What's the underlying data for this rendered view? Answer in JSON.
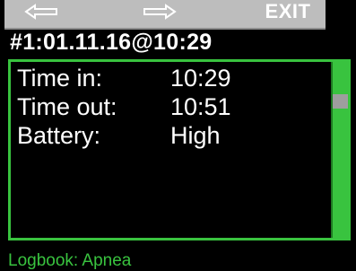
{
  "softkeys": {
    "left_icon": "arrow-left-icon",
    "right_icon": "arrow-right-icon",
    "exit_label": "EXIT"
  },
  "header": {
    "title": "#1:01.11.16@10:29"
  },
  "details": [
    {
      "label": "Time in:",
      "value": "10:29"
    },
    {
      "label": "Time out:",
      "value": "10:51"
    },
    {
      "label": "Battery:",
      "value": "High"
    }
  ],
  "scrollbar": {
    "position_fraction": 0.2
  },
  "footer": {
    "label": "Logbook: Apnea"
  },
  "colors": {
    "accent": "#39c33f",
    "softkey_bar": "#bdbdbd",
    "background": "#000000",
    "text": "#ffffff"
  }
}
